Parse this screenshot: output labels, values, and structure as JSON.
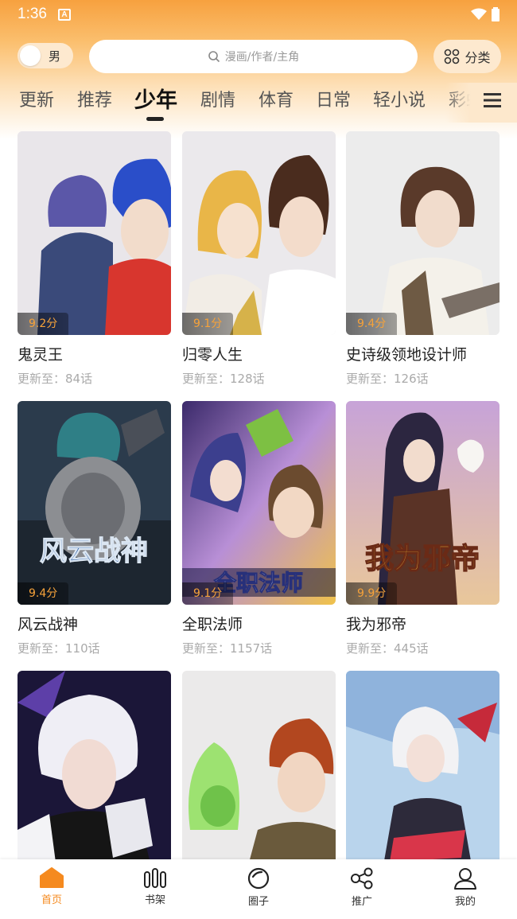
{
  "status_bar": {
    "time": "1:36",
    "notification_badge": "A"
  },
  "header": {
    "gender_label": "男",
    "search_placeholder": "漫画/作者/主角",
    "category_label": "分类"
  },
  "tabs": [
    "更新",
    "推荐",
    "少年",
    "剧情",
    "体育",
    "日常",
    "轻小说",
    "彩虹"
  ],
  "active_tab": "少年",
  "comics": [
    {
      "title": "鬼灵王",
      "update": "更新至：84话",
      "score": "9.2分"
    },
    {
      "title": "归零人生",
      "update": "更新至：128话",
      "score": "9.1分"
    },
    {
      "title": "史诗级领地设计师",
      "update": "更新至：126话",
      "score": "9.4分"
    },
    {
      "title": "风云战神",
      "update": "更新至：110话",
      "score": "9.4分"
    },
    {
      "title": "全职法师",
      "update": "更新至：1157话",
      "score": "9.1分"
    },
    {
      "title": "我为邪帝",
      "update": "更新至：445话",
      "score": "9.9分"
    },
    {
      "title": "",
      "update": "",
      "score": ""
    },
    {
      "title": "",
      "update": "",
      "score": ""
    },
    {
      "title": "",
      "update": "",
      "score": ""
    }
  ],
  "cover_text": [
    "风云战神",
    "全职法师",
    "我为邪帝"
  ],
  "bottom_nav": [
    {
      "label": "首页",
      "icon": "home-icon",
      "active": true
    },
    {
      "label": "书架",
      "icon": "bookshelf-icon",
      "active": false
    },
    {
      "label": "圈子",
      "icon": "circle-icon",
      "active": false
    },
    {
      "label": "推广",
      "icon": "share-icon",
      "active": false
    },
    {
      "label": "我的",
      "icon": "profile-icon",
      "active": false
    }
  ],
  "colors": {
    "accent": "#f58a1f",
    "score": "#f6a23a",
    "header_top": "#f7a13f"
  }
}
